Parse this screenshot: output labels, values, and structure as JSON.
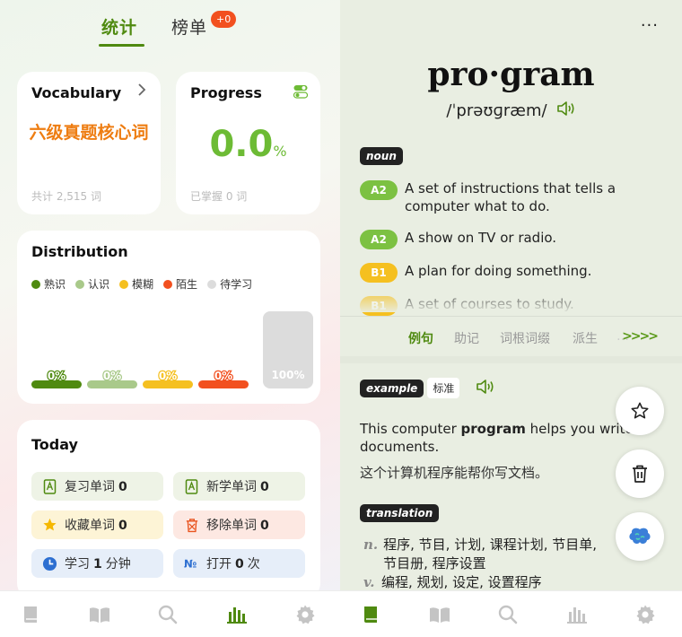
{
  "left": {
    "tabs": {
      "stats": "统计",
      "ranking": "榜单",
      "ranking_badge": "+0"
    },
    "vocabulary": {
      "title": "Vocabulary",
      "book": "六级真题核心词",
      "total": "共计 2,515 词"
    },
    "progress": {
      "title": "Progress",
      "value": "0.0",
      "unit": "%",
      "mastered": "已掌握 0 词"
    },
    "distribution": {
      "title": "Distribution",
      "legend": [
        {
          "label": "熟识",
          "color": "#4f8a10"
        },
        {
          "label": "认识",
          "color": "#a9c98a"
        },
        {
          "label": "模糊",
          "color": "#f5c020"
        },
        {
          "label": "陌生",
          "color": "#f2501f"
        },
        {
          "label": "待学习",
          "color": "#dcdcdc"
        }
      ]
    },
    "today": {
      "title": "Today",
      "items": [
        {
          "label": "复习单词",
          "value": "0",
          "icon": "book-icon",
          "bg": "#eef3e6"
        },
        {
          "label": "新学单词",
          "value": "0",
          "icon": "book-icon",
          "bg": "#eef3e6"
        },
        {
          "label": "收藏单词",
          "value": "0",
          "icon": "star-icon",
          "bg": "#fdf4d6"
        },
        {
          "label": "移除单词",
          "value": "0",
          "icon": "trash-icon",
          "bg": "#fde8e2"
        },
        {
          "label": "学习",
          "value": "1",
          "unit": "分钟",
          "icon": "clock-icon",
          "bg": "#e6eef9"
        },
        {
          "label": "打开",
          "value": "0",
          "unit": "次",
          "icon": "number-icon",
          "bg": "#e6eef9"
        }
      ]
    }
  },
  "chart_data": {
    "type": "bar",
    "categories": [
      "熟识",
      "认识",
      "模糊",
      "陌生",
      "待学习"
    ],
    "values": [
      0,
      0,
      0,
      0,
      100
    ],
    "value_labels": [
      "0%",
      "0%",
      "0%",
      "0%",
      "100%"
    ],
    "colors": [
      "#4f8a10",
      "#a9c98a",
      "#f5c020",
      "#f2501f",
      "#dcdcdc"
    ],
    "ylim": [
      0,
      100
    ]
  },
  "right": {
    "more": "···",
    "word": "pro·gram",
    "phonetic": "/ˈprəʊɡræm/",
    "noun_tag": "noun",
    "senses": [
      {
        "level": "A2",
        "color": "#7cc142",
        "text": "A set of instructions that tells a computer what to do."
      },
      {
        "level": "A2",
        "color": "#7cc142",
        "text": "A show on TV or radio."
      },
      {
        "level": "B1",
        "color": "#f5c020",
        "text": "A plan for doing something."
      },
      {
        "level": "B1",
        "color": "#f5c020",
        "text": "A set of courses to study."
      }
    ],
    "subtabs": [
      "例句",
      "助记",
      "词根词缀",
      "派生",
      "…"
    ],
    "arrows": ">>>>",
    "example": {
      "tag": "example",
      "standard": "标准",
      "en_before": "This computer ",
      "en_bold": "program",
      "en_after": " helps you write documents.",
      "zh": "这个计算机程序能帮你写文档。"
    },
    "translation": {
      "tag": "translation",
      "lines": [
        {
          "pos": "n.",
          "text": "程序, 节目, 计划, 课程计划, 节目单, 节目册, 程序设置"
        },
        {
          "pos": "v.",
          "text": "编程, 规划, 设定, 设置程序"
        }
      ]
    }
  },
  "nav": {
    "left": [
      "book-icon",
      "open-book-icon",
      "search-icon",
      "stats-icon",
      "gear-icon"
    ],
    "right": [
      "book-icon",
      "open-book-icon",
      "search-icon",
      "stats-icon",
      "gear-icon"
    ]
  }
}
